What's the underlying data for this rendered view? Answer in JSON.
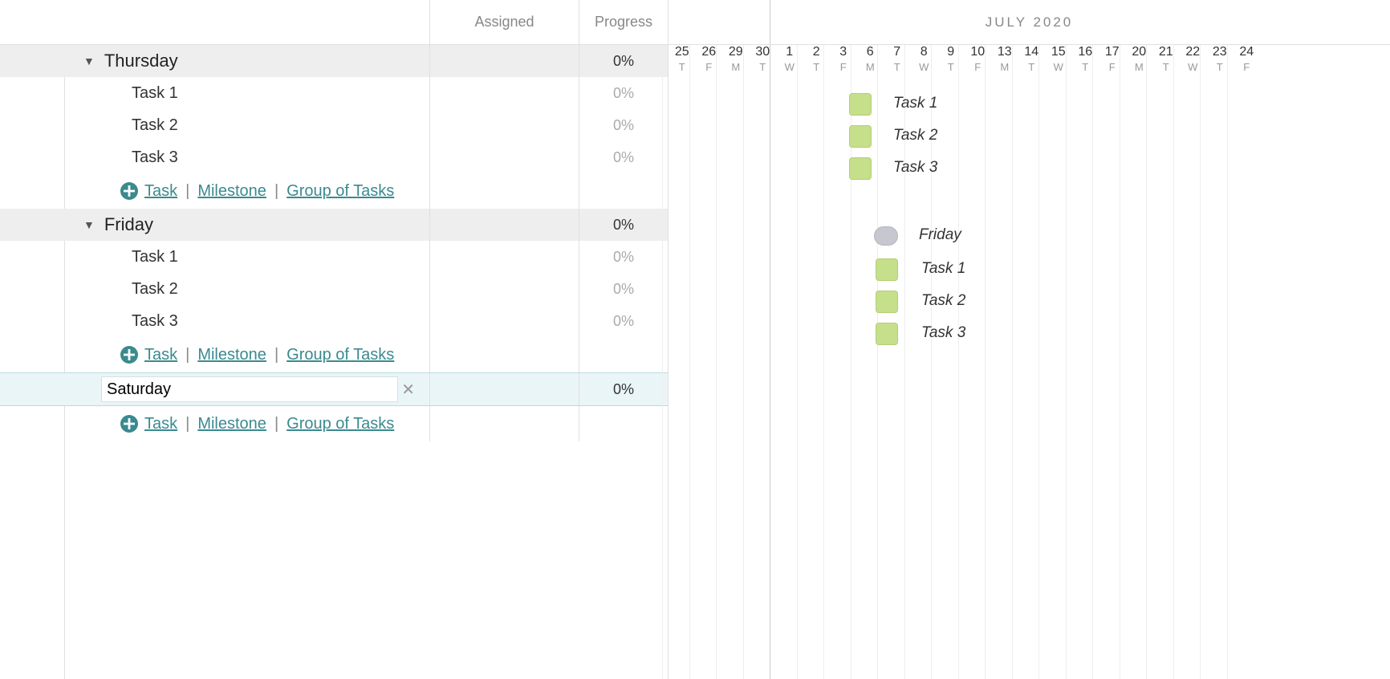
{
  "headers": {
    "assigned": "Assigned",
    "progress": "Progress"
  },
  "timeline": {
    "month_label": "JULY 2020",
    "days": [
      {
        "n": "25",
        "l": "T"
      },
      {
        "n": "26",
        "l": "F"
      },
      {
        "n": "29",
        "l": "M"
      },
      {
        "n": "30",
        "l": "T"
      },
      {
        "n": "1",
        "l": "W"
      },
      {
        "n": "2",
        "l": "T"
      },
      {
        "n": "3",
        "l": "F"
      },
      {
        "n": "6",
        "l": "M"
      },
      {
        "n": "7",
        "l": "T"
      },
      {
        "n": "8",
        "l": "W"
      },
      {
        "n": "9",
        "l": "T"
      },
      {
        "n": "10",
        "l": "F"
      },
      {
        "n": "13",
        "l": "M"
      },
      {
        "n": "14",
        "l": "T"
      },
      {
        "n": "15",
        "l": "W"
      },
      {
        "n": "16",
        "l": "T"
      },
      {
        "n": "17",
        "l": "F"
      },
      {
        "n": "20",
        "l": "M"
      },
      {
        "n": "21",
        "l": "T"
      },
      {
        "n": "22",
        "l": "W"
      },
      {
        "n": "23",
        "l": "T"
      },
      {
        "n": "24",
        "l": "F"
      }
    ]
  },
  "groups": [
    {
      "name": "Thursday",
      "progress": "0%",
      "tasks": [
        {
          "name": "Task 1",
          "progress": "0%"
        },
        {
          "name": "Task 2",
          "progress": "0%"
        },
        {
          "name": "Task 3",
          "progress": "0%"
        }
      ]
    },
    {
      "name": "Friday",
      "progress": "0%",
      "tasks": [
        {
          "name": "Task 1",
          "progress": "0%"
        },
        {
          "name": "Task 2",
          "progress": "0%"
        },
        {
          "name": "Task 3",
          "progress": "0%"
        }
      ]
    }
  ],
  "editing": {
    "value": "Saturday",
    "progress": "0%"
  },
  "add_links": {
    "task": "Task",
    "milestone": "Milestone",
    "group": "Group of Tasks"
  },
  "gantt": {
    "thursday": {
      "label_t1": "Task 1",
      "label_t2": "Task 2",
      "label_t3": "Task 3"
    },
    "friday": {
      "group_label": "Friday",
      "label_t1": "Task 1",
      "label_t2": "Task 2",
      "label_t3": "Task 3"
    }
  }
}
